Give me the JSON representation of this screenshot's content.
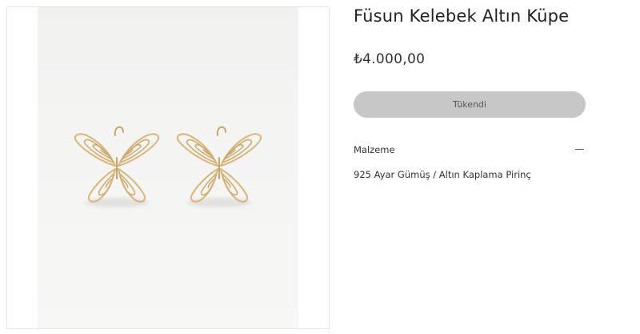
{
  "product": {
    "title": "Füsun Kelebek Altın Küpe",
    "price": "₺4.000,00",
    "button_label": "Tükendi",
    "image_icon": "butterfly-earrings-image"
  },
  "details": {
    "section_title": "Malzeme",
    "toggle_icon": "minus-icon",
    "content": "925 Ayar Gümüş / Altın Kaplama Pirinç"
  },
  "colors": {
    "gold": "#d8b77a",
    "button_bg": "#c7c7c7",
    "text": "#222222"
  }
}
